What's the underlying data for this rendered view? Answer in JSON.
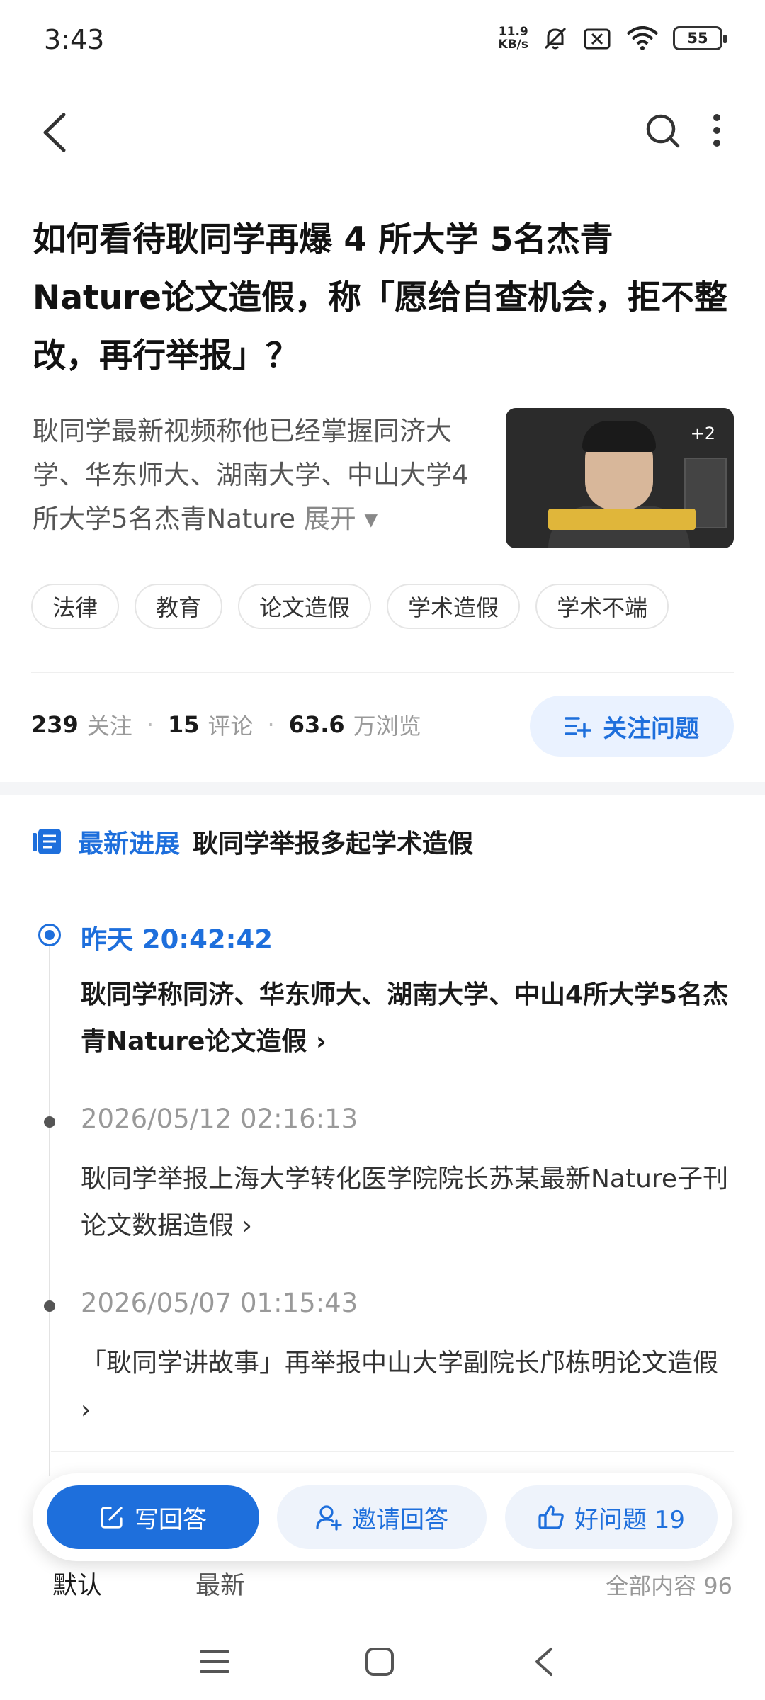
{
  "status_bar": {
    "time": "3:43",
    "net_speed_value": "11.9",
    "net_speed_unit": "KB/s",
    "battery": "55"
  },
  "question": {
    "title": "如何看待耿同学再爆 4 所大学 5名杰青Nature论文造假，称「愿给自查机会，拒不整改，再行举报」？",
    "summary": "耿同学最新视频称他已经掌握同济大学、华东师大、湖南大学、中山大学4所大学5名杰青Nature",
    "expand_label": "展开",
    "thumbnail_badge": "+2",
    "tags": [
      "法律",
      "教育",
      "论文造假",
      "学术造假",
      "学术不端"
    ]
  },
  "stats": {
    "follow_count": "239",
    "follow_label": "关注",
    "comment_count": "15",
    "comment_label": "评论",
    "view_count": "63.6",
    "view_unit_label": "万浏览",
    "follow_button_label": "关注问题"
  },
  "progress": {
    "header_label": "最新进展",
    "topic": "耿同学举报多起学术造假",
    "items": [
      {
        "time": "昨天  20:42:42",
        "text": "耿同学称同济、华东师大、湖南大学、中山4所大学5名杰青Nature论文造假 ›"
      },
      {
        "time": "2026/05/12  02:16:13",
        "text": "耿同学举报上海大学转化医学院院长苏某最新Nature子刊论文数据造假 ›"
      },
      {
        "time": "2026/05/07  01:15:43",
        "text": "「耿同学讲故事」再举报中山大学副院长邝栋明论文造假 ›"
      }
    ]
  },
  "actions": {
    "write_answer": "写回答",
    "invite_answer": "邀请回答",
    "good_question": "好问题 19"
  },
  "sort": {
    "default": "默认",
    "latest": "最新",
    "all_content": "全部内容 96"
  },
  "colors": {
    "accent": "#1e6fdc",
    "accent_light": "#eaf2ff"
  }
}
